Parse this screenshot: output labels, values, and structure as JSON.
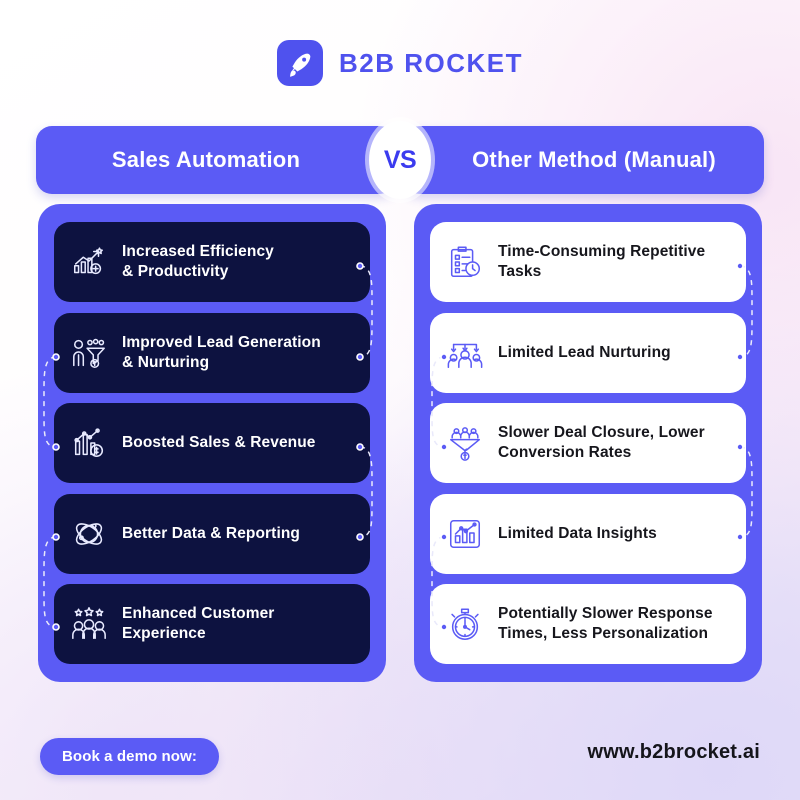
{
  "brand": {
    "name": "B2B ROCKET",
    "logo_icon": "rocket-icon",
    "accent_color": "#4f52ee"
  },
  "header": {
    "left_label": "Sales Automation",
    "vs_label": "VS",
    "right_label": "Other Method (Manual)",
    "banner_color": "#5b5bf5"
  },
  "columns": {
    "left": {
      "panel_color": "#5b5bf5",
      "card_color": "#0d1240",
      "items": [
        {
          "icon": "growth-chart-gear-icon",
          "label": "Increased Efficiency\n& Productivity"
        },
        {
          "icon": "lead-funnel-people-icon",
          "label": "Improved Lead Generation\n& Nurturing"
        },
        {
          "icon": "bar-chart-dollar-icon",
          "label": "Boosted Sales & Revenue"
        },
        {
          "icon": "atom-data-icon",
          "label": "Better Data & Reporting"
        },
        {
          "icon": "stars-people-icon",
          "label": "Enhanced Customer\nExperience"
        }
      ]
    },
    "right": {
      "panel_color": "#5b5bf5",
      "card_color": "#ffffff",
      "items": [
        {
          "icon": "clipboard-clock-icon",
          "label": "Time-Consuming Repetitive\nTasks"
        },
        {
          "icon": "team-network-icon",
          "label": "Limited Lead Nurturing"
        },
        {
          "icon": "funnel-dollar-icon",
          "label": "Slower Deal Closure, Lower\nConversion Rates"
        },
        {
          "icon": "bar-chart-insights-icon",
          "label": "Limited Data Insights"
        },
        {
          "icon": "stopwatch-icon",
          "label": "Potentially Slower Response\nTimes, Less Personalization"
        }
      ]
    }
  },
  "footer": {
    "cta_label": "Book a demo now:",
    "website": "www.b2brocket.ai"
  }
}
